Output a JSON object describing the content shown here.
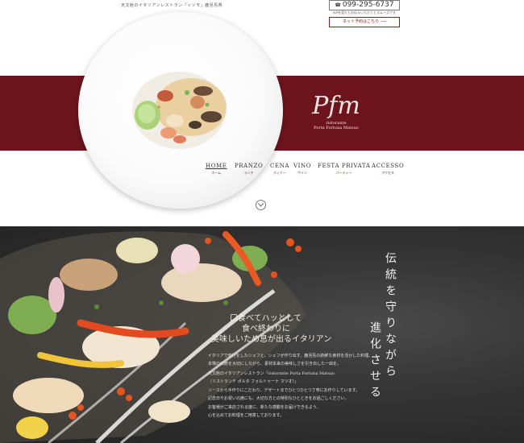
{
  "header": {
    "tagline": "天文館のイタリアンレストラン「ッソモ」鹿児島県",
    "phone": "099-295-6737",
    "phone_note": "HPを見たとお伝えいただくとスムーズです",
    "reserve_label": "ネット予約はこちら ⟶"
  },
  "logo": {
    "mark": "Pfm",
    "line1": "ristorante",
    "line2": "Porta Fortuna Matsuo"
  },
  "nav": [
    {
      "en": "HOME",
      "ja": "ホーム",
      "active": true
    },
    {
      "en": "PRANZO",
      "ja": "ランチ"
    },
    {
      "en": "CENA",
      "ja": "ディナー"
    },
    {
      "en": "VINO",
      "ja": "ワイン"
    },
    {
      "en": "FESTA PRIVATA",
      "ja": "パーティー"
    },
    {
      "en": "ACCESSO",
      "ja": "アクセス"
    }
  ],
  "hero2": {
    "vertical_lines": [
      "伝統を守りながら",
      "進化させる"
    ],
    "catch": [
      "口食べてハッとして",
      "食べ終わりに",
      "美味しいため息が出るイタリアン"
    ],
    "description": [
      "イタリアで修行をしたシェフと、シェフが作り出す、鹿児島の新鮮な食材を活かした料理。",
      "本場の伝統を大切にしながら、素材本来の美味しさを引き出した一皿を。",
      "天文館のイタリアンレストラン「ristorante Porta Fortuna Matsuo",
      "（リストランテ ポルタ フォルトゥーナ マツオ）」",
      "ソースから手作りにこだわり、デザートまでひとつひとつ丁寧にお作りしています。",
      "記念日やお祝いの席にも、大切な方との特別なひとときをお過ごしください。",
      "お客様がご来店される度に、新たな感動をお届けできるよう、",
      "心を込めてお料理をご用意しております。"
    ]
  },
  "colors": {
    "brand": "#6e141c",
    "text": "#333333"
  }
}
